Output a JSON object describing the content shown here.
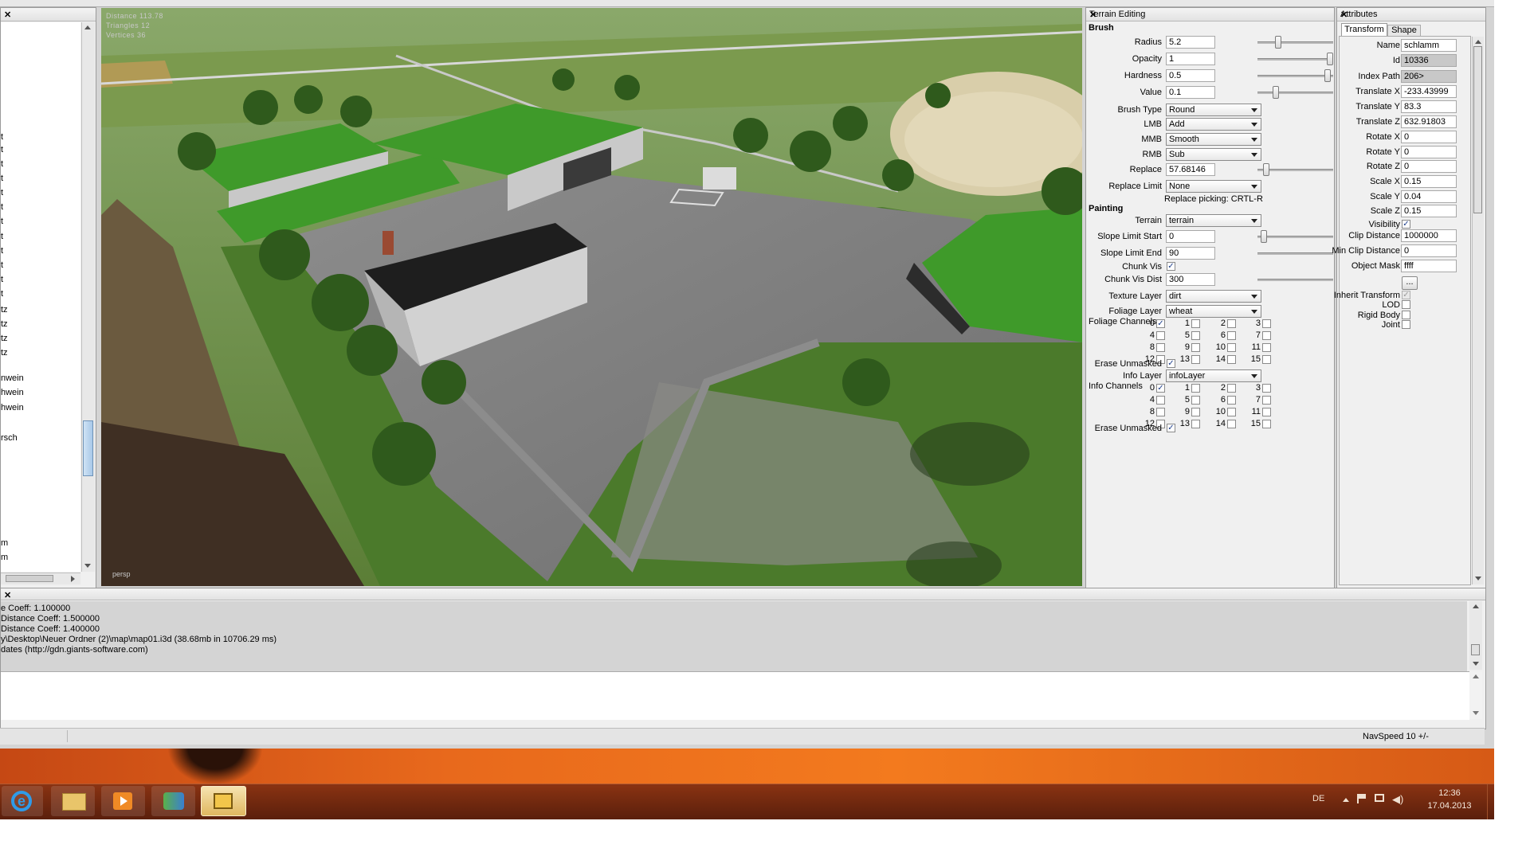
{
  "viewport": {
    "stats": [
      "Distance 113.78",
      "Triangles 12",
      "Vertices 36"
    ],
    "camera": "persp"
  },
  "left_panel": {
    "items": [
      "t",
      "t",
      "t",
      "t",
      "t",
      "t",
      "t",
      "t",
      "t",
      "t",
      "t",
      "t",
      "tz",
      "tz",
      "tz",
      "tz",
      "nwein",
      "hwein",
      "hwein",
      "rsch",
      "m",
      "m"
    ]
  },
  "terrain_editing": {
    "title": "Terrain Editing",
    "brush_section": "Brush",
    "radius": {
      "label": "Radius",
      "value": "5.2",
      "slider": 0.25
    },
    "opacity": {
      "label": "Opacity",
      "value": "1",
      "slider": 1.0
    },
    "hardness": {
      "label": "Hardness",
      "value": "0.5",
      "slider": 0.97
    },
    "value": {
      "label": "Value",
      "value": "0.1",
      "slider": 0.22
    },
    "brush_type": {
      "label": "Brush Type",
      "value": "Round"
    },
    "lmb": {
      "label": "LMB",
      "value": "Add"
    },
    "mmb": {
      "label": "MMB",
      "value": "Smooth"
    },
    "rmb": {
      "label": "RMB",
      "value": "Sub"
    },
    "replace": {
      "label": "Replace",
      "value": "57.68146",
      "slider": 0.08
    },
    "replace_limit": {
      "label": "Replace Limit",
      "value": "None"
    },
    "replace_picking": "Replace picking: CRTL-R",
    "painting_section": "Painting",
    "terrain": {
      "label": "Terrain",
      "value": "terrain"
    },
    "slope_limit_start": {
      "label": "Slope Limit Start",
      "value": "0",
      "slider": 0.05
    },
    "slope_limit_end": {
      "label": "Slope Limit End",
      "value": "90"
    },
    "chunk_vis": {
      "label": "Chunk Vis",
      "checked": true
    },
    "chunk_vis_dist": {
      "label": "Chunk Vis Dist",
      "value": "300"
    },
    "texture_layer": {
      "label": "Texture Layer",
      "value": "dirt"
    },
    "foliage_layer": {
      "label": "Foliage Layer",
      "value": "wheat"
    },
    "foliage_channels_label": "Foliage Channels",
    "foliage_checked": [
      0
    ],
    "erase_unmasked_1": {
      "label": "Erase Unmasked",
      "checked": true
    },
    "info_layer": {
      "label": "Info Layer",
      "value": "infoLayer"
    },
    "info_channels_label": "Info Channels",
    "info_checked": [
      0
    ],
    "erase_unmasked_2": {
      "label": "Erase Unmasked",
      "checked": true
    },
    "channel_numbers": [
      "0",
      "1",
      "2",
      "3",
      "4",
      "5",
      "6",
      "7",
      "8",
      "9",
      "10",
      "11",
      "12",
      "13",
      "14",
      "15"
    ]
  },
  "attributes": {
    "title": "Attributes",
    "tabs": [
      "Transform",
      "Shape"
    ],
    "fields": [
      {
        "label": "Name",
        "value": "schlamm",
        "ro": false
      },
      {
        "label": "Id",
        "value": "10336",
        "ro": true
      },
      {
        "label": "Index Path",
        "value": "206>",
        "ro": true
      },
      {
        "label": "Translate X",
        "value": "-233.43999",
        "ro": false
      },
      {
        "label": "Translate Y",
        "value": "83.3",
        "ro": false
      },
      {
        "label": "Translate Z",
        "value": "632.91803",
        "ro": false
      },
      {
        "label": "Rotate X",
        "value": "0",
        "ro": false
      },
      {
        "label": "Rotate Y",
        "value": "0",
        "ro": false
      },
      {
        "label": "Rotate Z",
        "value": "0",
        "ro": false
      },
      {
        "label": "Scale X",
        "value": "0.15",
        "ro": false
      },
      {
        "label": "Scale Y",
        "value": "0.04",
        "ro": false
      },
      {
        "label": "Scale Z",
        "value": "0.15",
        "ro": false
      }
    ],
    "visibility": {
      "label": "Visibility",
      "checked": true
    },
    "clip_distance": {
      "label": "Clip Distance",
      "value": "1000000"
    },
    "min_clip_distance": {
      "label": "Min Clip Distance",
      "value": "0"
    },
    "object_mask": {
      "label": "Object Mask",
      "value": "ffff"
    },
    "ellipsis_button": "...",
    "inherit_transform": {
      "label": "Inherit Transform",
      "checked": true
    },
    "lod": {
      "label": "LOD",
      "checked": false
    },
    "rigid_body": {
      "label": "Rigid Body",
      "checked": false
    },
    "joint": {
      "label": "Joint",
      "checked": false
    }
  },
  "log": {
    "lines": [
      "e Coeff: 1.100000",
      "Distance Coeff: 1.500000",
      "Distance Coeff: 1.400000",
      "y\\Desktop\\Neuer Ordner (2)\\map\\map01.i3d (38.68mb in 10706.29 ms)",
      "dates (http://gdn.giants-software.com)"
    ]
  },
  "status": {
    "navspeed": "NavSpeed 10 +/-"
  },
  "taskbar": {
    "language": "DE",
    "time": "12:36",
    "date": "17.04.2013"
  },
  "colors": {
    "panel_bg": "#f0f0f0",
    "accent": "#1b3c8a",
    "roof_green": "#3f9a2a"
  }
}
